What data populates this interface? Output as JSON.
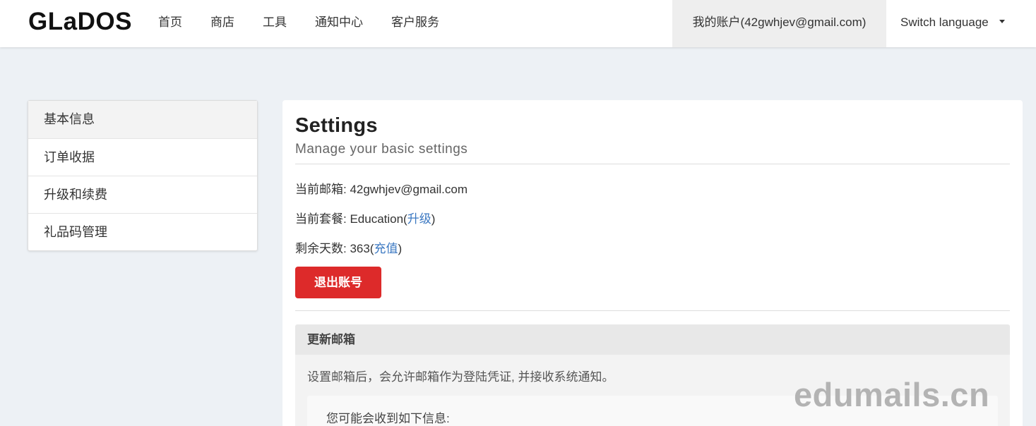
{
  "header": {
    "brand": "GLaDOS",
    "nav": [
      "首页",
      "商店",
      "工具",
      "通知中心",
      "客户服务"
    ],
    "account": "我的账户(42gwhjev@gmail.com)",
    "language": "Switch language"
  },
  "sidebar": {
    "items": [
      "基本信息",
      "订单收据",
      "升级和续费",
      "礼品码管理"
    ]
  },
  "main": {
    "title": "Settings",
    "subtitle": "Manage your basic settings",
    "email_label": "当前邮箱: 42gwhjev@gmail.com",
    "plan_label": "当前套餐: Education(",
    "plan_link": "升级",
    "plan_close": ")",
    "days_label": "剩余天数: 363(",
    "days_link": "充值",
    "days_close": ")",
    "logout": "退出账号"
  },
  "panel": {
    "header": "更新邮箱",
    "description": "设置邮箱后，会允许邮箱作为登陆凭证, 并接收系统通知。",
    "inner_text": "您可能会收到如下信息:"
  },
  "watermark": "edumails.cn"
}
